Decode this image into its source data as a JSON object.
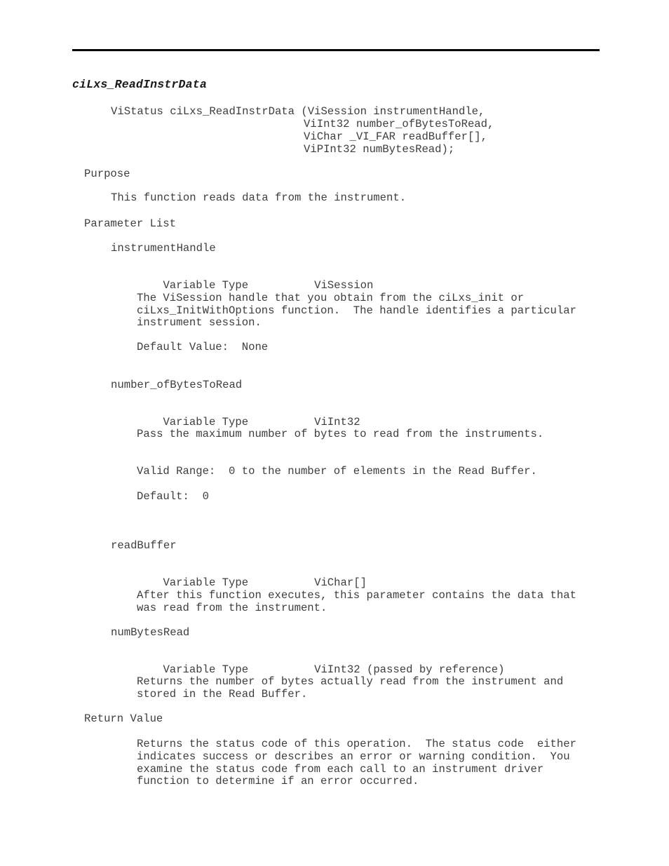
{
  "document": {
    "function_name": "ciLxs_ReadInstrData",
    "prototype": {
      "line1": "ViStatus ciLxs_ReadInstrData (ViSession instrumentHandle,",
      "line2": "ViInt32 number_ofBytesToRead,",
      "line3": "ViChar _VI_FAR readBuffer[],",
      "line4": "ViPInt32 numBytesRead);"
    },
    "sections": {
      "purpose": {
        "heading": "Purpose",
        "body": "This function reads data from the instrument."
      },
      "parameter_list": {
        "heading": "Parameter List"
      },
      "return_value": {
        "heading": "Return Value",
        "body_line1": "Returns the status code of this operation.  The status code  either",
        "body_line2": "indicates success or describes an error or warning condition.  You",
        "body_line3": "examine the status code from each call to an instrument driver",
        "body_line4": "function to determine if an error occurred."
      }
    },
    "parameters": [
      {
        "name": "instrumentHandle",
        "variable_type_label": "Variable Type",
        "variable_type_value": "ViSession",
        "description_line1": "The ViSession handle that you obtain from the ciLxs_init or",
        "description_line2": "ciLxs_InitWithOptions function.  The handle identifies a particular",
        "description_line3": "instrument session.",
        "default_label": "Default Value:  None"
      },
      {
        "name": "number_ofBytesToRead",
        "variable_type_label": "Variable Type",
        "variable_type_value": "ViInt32",
        "description_line1": "Pass the maximum number of bytes to read from the instruments.",
        "valid_range": "Valid Range:  0 to the number of elements in the Read Buffer.",
        "default_label": "Default:  0"
      },
      {
        "name": "readBuffer",
        "variable_type_label": "Variable Type",
        "variable_type_value": "ViChar[]",
        "description_line1": "After this function executes, this parameter contains the data that",
        "description_line2": "was read from the instrument."
      },
      {
        "name": "numBytesRead",
        "variable_type_label": "Variable Type",
        "variable_type_value": "ViInt32 (passed by reference)",
        "description_line1": "Returns the number of bytes actually read from the instrument and",
        "description_line2": "stored in the Read Buffer."
      }
    ],
    "colors": {
      "text": "#3d3d3d",
      "rule": "#000000",
      "background": "#ffffff"
    }
  }
}
